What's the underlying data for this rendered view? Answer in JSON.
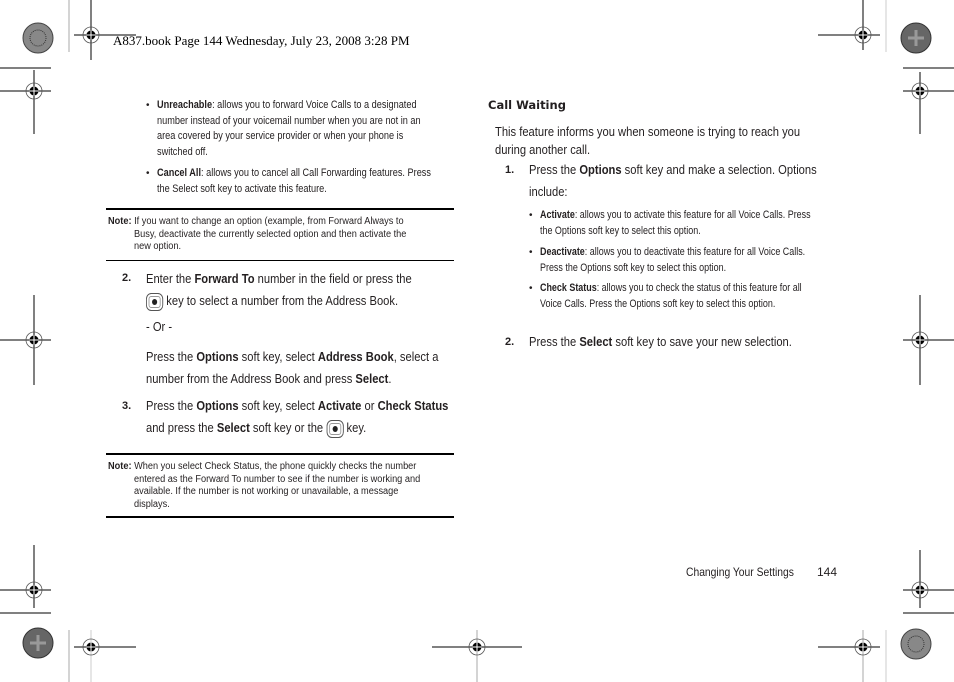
{
  "header": {
    "print_line": "A837.book  Page 144  Wednesday, July 23, 2008  3:28 PM"
  },
  "left_column": {
    "bullets": [
      {
        "term": "Unreachable",
        "lines": [
          ": allows you to forward Voice Calls to a designated",
          "number instead of your voicemail number when you are not in an",
          "area covered by your service provider or when your phone is",
          "switched off."
        ]
      },
      {
        "term": "Cancel All",
        "lines": [
          ": allows you to cancel all Call Forwarding features. Press",
          "the Select soft key to activate this feature."
        ]
      }
    ],
    "note1": {
      "label": "Note:",
      "lines": [
        "If you want to change an option (example, from Forward Always to",
        "Busy, deactivate the currently selected option and then activate the",
        "new option."
      ]
    },
    "step2": {
      "number": "2.",
      "t1": "Enter the ",
      "b1": "Forward To",
      "t2": " number in the field or press the",
      "t3": " key to select a number from the Address Book.",
      "or": "- Or -",
      "t4": "Press the ",
      "b2": "Options",
      "t5": " soft key, select ",
      "b3": "Address Book",
      "t6": ", select a",
      "t7": "number from the Address Book and press ",
      "b4": "Select",
      "t8": "."
    },
    "step3": {
      "number": "3.",
      "t1": "Press the ",
      "b1": "Options",
      "t2": " soft key, select ",
      "b2": "Activate",
      "t3": " or ",
      "b3": "Check Status",
      "t4": "and press the ",
      "b4": "Select",
      "t5": " soft key or the ",
      "t6": " key."
    },
    "note2": {
      "label": "Note:",
      "lines": [
        "When you select Check Status, the phone quickly checks the number",
        "entered as the Forward To number to see if the number is working and",
        "available. If the number is not working or unavailable, a message",
        "displays."
      ]
    }
  },
  "right_column": {
    "heading": "Call Waiting",
    "intro": [
      "This feature informs you when someone is trying to reach you",
      "during another call."
    ],
    "step1": {
      "number": "1.",
      "t1": "Press the ",
      "b1": "Options",
      "t2": " soft key and make a selection. Options",
      "t3": "include:"
    },
    "bullets": [
      {
        "term": "Activate",
        "lines": [
          ": allows you to activate this feature for all Voice Calls. Press",
          "the Options soft key to select this option."
        ]
      },
      {
        "term": "Deactivate",
        "lines": [
          ": allows you to deactivate this feature for all Voice Calls.",
          "Press the Options soft key to select this option."
        ]
      },
      {
        "term": "Check Status",
        "lines": [
          ": allows you to check the status of this feature for all",
          "Voice Calls. Press the Options soft key to select this option."
        ]
      }
    ],
    "step2": {
      "number": "2.",
      "t1": "Press the ",
      "b1": "Select",
      "t2": " soft key to save your new selection."
    }
  },
  "footer": {
    "section": "Changing Your Settings",
    "page": "144"
  },
  "icons": {
    "bullet": "•"
  }
}
